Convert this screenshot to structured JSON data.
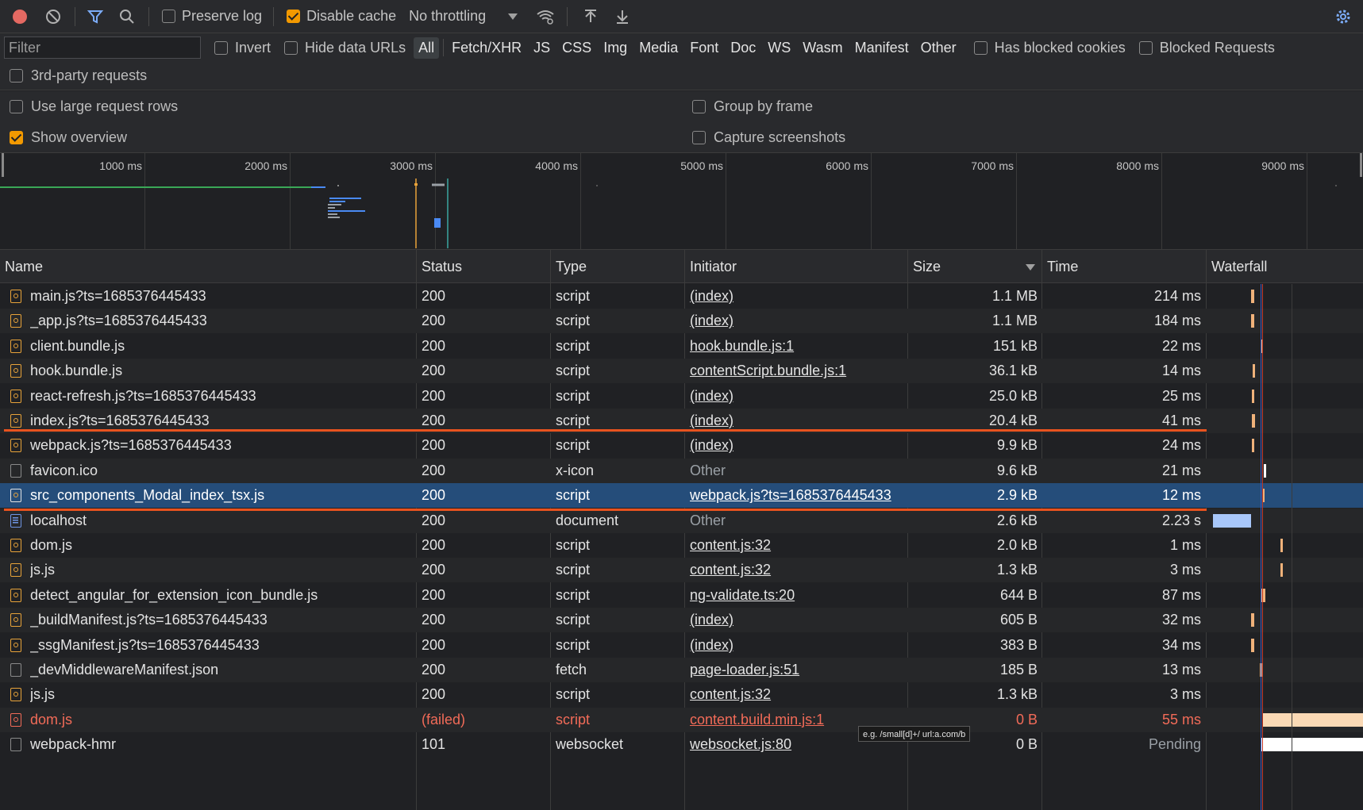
{
  "toolbar": {
    "preserve_log_label": "Preserve log",
    "preserve_log_checked": false,
    "disable_cache_label": "Disable cache",
    "disable_cache_checked": true,
    "throttling": "No throttling"
  },
  "filter": {
    "placeholder": "Filter",
    "invert_label": "Invert",
    "hide_data_urls_label": "Hide data URLs",
    "types": [
      "All",
      "Fetch/XHR",
      "JS",
      "CSS",
      "Img",
      "Media",
      "Font",
      "Doc",
      "WS",
      "Wasm",
      "Manifest",
      "Other"
    ],
    "active_type": "All",
    "has_blocked_cookies_label": "Has blocked cookies",
    "blocked_requests_label": "Blocked Requests",
    "third_party_label": "3rd-party requests"
  },
  "settings": {
    "large_rows_label": "Use large request rows",
    "group_by_frame_label": "Group by frame",
    "show_overview_label": "Show overview",
    "show_overview_checked": true,
    "capture_screenshots_label": "Capture screenshots"
  },
  "overview": {
    "ticks": [
      "1000 ms",
      "2000 ms",
      "3000 ms",
      "4000 ms",
      "5000 ms",
      "6000 ms",
      "7000 ms",
      "8000 ms",
      "9000 ms"
    ]
  },
  "table": {
    "headers": {
      "name": "Name",
      "status": "Status",
      "type": "Type",
      "initiator": "Initiator",
      "size": "Size",
      "time": "Time",
      "waterfall": "Waterfall"
    },
    "rows": [
      {
        "name": "main.js?ts=1685376445433",
        "status": "200",
        "type": "script",
        "initiator": "(index)",
        "size": "1.1 MB",
        "time": "214 ms"
      },
      {
        "name": "_app.js?ts=1685376445433",
        "status": "200",
        "type": "script",
        "initiator": "(index)",
        "size": "1.1 MB",
        "time": "184 ms"
      },
      {
        "name": "client.bundle.js",
        "status": "200",
        "type": "script",
        "initiator": "hook.bundle.js:1",
        "size": "151 kB",
        "time": "22 ms"
      },
      {
        "name": "hook.bundle.js",
        "status": "200",
        "type": "script",
        "initiator": "contentScript.bundle.js:1",
        "size": "36.1 kB",
        "time": "14 ms"
      },
      {
        "name": "react-refresh.js?ts=1685376445433",
        "status": "200",
        "type": "script",
        "initiator": "(index)",
        "size": "25.0 kB",
        "time": "25 ms"
      },
      {
        "name": "index.js?ts=1685376445433",
        "status": "200",
        "type": "script",
        "initiator": "(index)",
        "size": "20.4 kB",
        "time": "41 ms"
      },
      {
        "name": "webpack.js?ts=1685376445433",
        "status": "200",
        "type": "script",
        "initiator": "(index)",
        "size": "9.9 kB",
        "time": "24 ms"
      },
      {
        "name": "favicon.ico",
        "status": "200",
        "type": "x-icon",
        "initiator": "Other",
        "size": "9.6 kB",
        "time": "21 ms"
      },
      {
        "name": "src_components_Modal_index_tsx.js",
        "status": "200",
        "type": "script",
        "initiator": "webpack.js?ts=1685376445433",
        "size": "2.9 kB",
        "time": "12 ms"
      },
      {
        "name": "localhost",
        "status": "200",
        "type": "document",
        "initiator": "Other",
        "size": "2.6 kB",
        "time": "2.23 s"
      },
      {
        "name": "dom.js",
        "status": "200",
        "type": "script",
        "initiator": "content.js:32",
        "size": "2.0 kB",
        "time": "1 ms"
      },
      {
        "name": "js.js",
        "status": "200",
        "type": "script",
        "initiator": "content.js:32",
        "size": "1.3 kB",
        "time": "3 ms"
      },
      {
        "name": "detect_angular_for_extension_icon_bundle.js",
        "status": "200",
        "type": "script",
        "initiator": "ng-validate.ts:20",
        "size": "644 B",
        "time": "87 ms"
      },
      {
        "name": "_buildManifest.js?ts=1685376445433",
        "status": "200",
        "type": "script",
        "initiator": "(index)",
        "size": "605 B",
        "time": "32 ms"
      },
      {
        "name": "_ssgManifest.js?ts=1685376445433",
        "status": "200",
        "type": "script",
        "initiator": "(index)",
        "size": "383 B",
        "time": "34 ms"
      },
      {
        "name": "_devMiddlewareManifest.json",
        "status": "200",
        "type": "fetch",
        "initiator": "page-loader.js:51",
        "size": "185 B",
        "time": "13 ms"
      },
      {
        "name": "js.js",
        "status": "200",
        "type": "script",
        "initiator": "content.js:32",
        "size": "1.3 kB",
        "time": "3 ms"
      },
      {
        "name": "dom.js",
        "status": "(failed)",
        "type": "script",
        "initiator": "content.build.min.js:1",
        "size": "0 B",
        "time": "55 ms"
      },
      {
        "name": "webpack-hmr",
        "status": "101",
        "type": "websocket",
        "initiator": "websocket.js:80",
        "size": "0 B",
        "time": "Pending"
      }
    ],
    "selected_index": 8
  },
  "tooltip": "e.g. /small[d]+/ url:a.com/b",
  "colors": {
    "accent_orange": "#f29900",
    "selected_row": "#254d7a",
    "highlight_line": "#e8531f",
    "failed_red": "#f26b58"
  }
}
